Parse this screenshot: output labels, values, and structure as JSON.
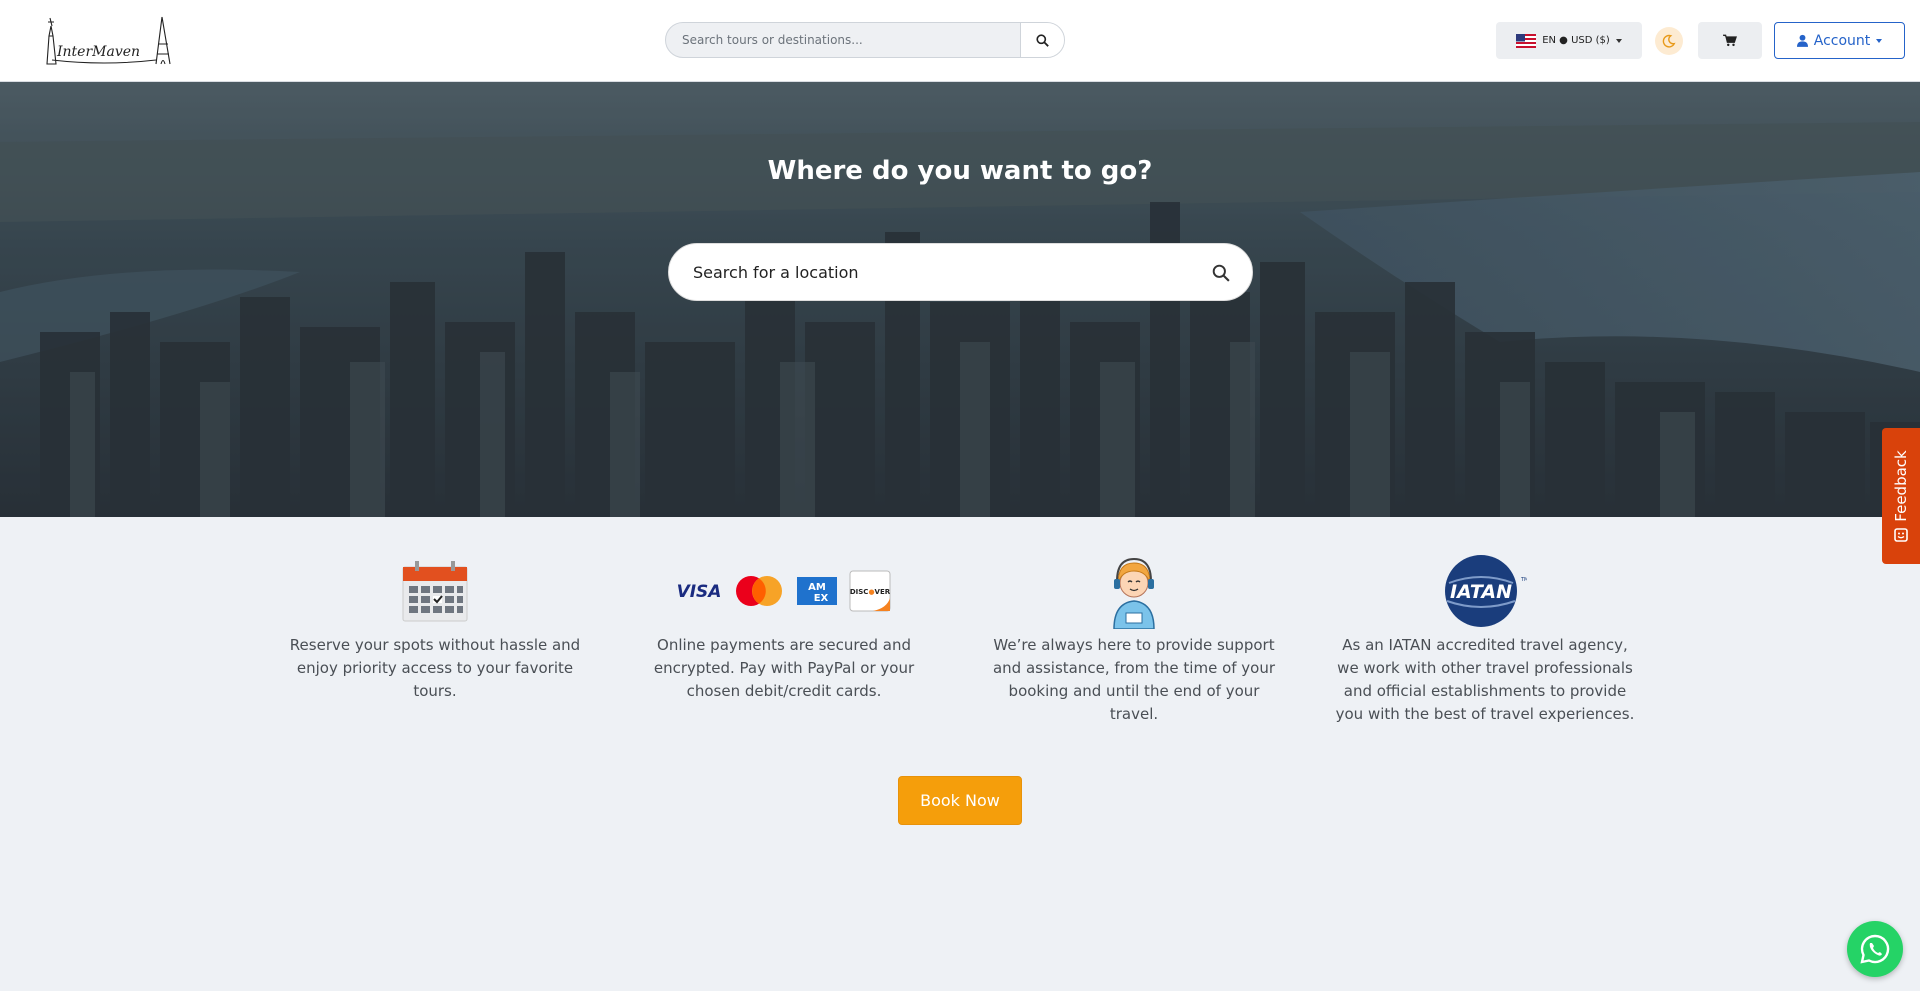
{
  "header": {
    "brand": "InterMaven",
    "search_placeholder": "Search tours or destinations...",
    "language_label": "EN ● USD ($)",
    "account_label": "Account"
  },
  "hero": {
    "title": "Where do you want to go?",
    "search_placeholder": "Search for a location"
  },
  "features": [
    {
      "icon": "calendar-icon",
      "text": "Reserve your spots without hassle and enjoy priority access to your favorite tours."
    },
    {
      "icon": "payment-cards-icon",
      "text": "Online payments are secured and encrypted. Pay with PayPal or your chosen debit/credit cards.",
      "cards": [
        "VISA",
        "AM EX",
        "DISCOVER"
      ]
    },
    {
      "icon": "support-agent-icon",
      "text": "We’re always here to provide support and assistance, from the time of your booking and until the end of your travel."
    },
    {
      "icon": "iatan-logo",
      "text": "As an IATAN accredited travel agency, we work with other travel professionals and official establishments to provide you with the best of travel experiences.",
      "logo_text": "IATAN"
    }
  ],
  "cta": {
    "label": "Book Now"
  },
  "feedback": {
    "label": "Feedback"
  },
  "colors": {
    "accent": "#f59e0b",
    "primary": "#2563c9",
    "feedback": "#d9420b",
    "whatsapp": "#25d366"
  }
}
